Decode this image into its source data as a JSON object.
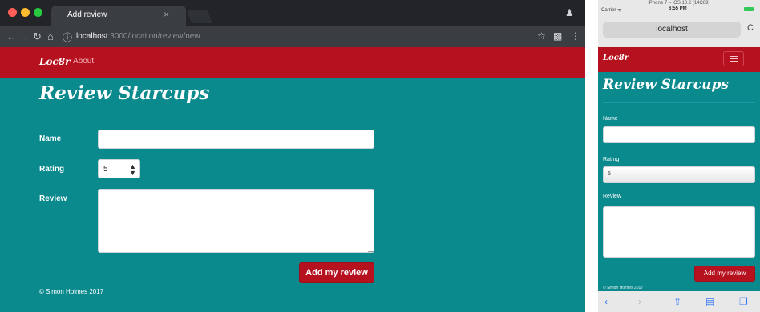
{
  "desktop": {
    "tab_title": "Add review",
    "tab_close": "×",
    "url_host": "localhost",
    "url_path": ":3000/location/review/new",
    "nav": {
      "brand": "Loc8r",
      "about": "About"
    },
    "heading": "Review Starcups",
    "form": {
      "name_label": "Name",
      "name_value": "",
      "rating_label": "Rating",
      "rating_value": "5",
      "review_label": "Review",
      "review_value": "",
      "submit_label": "Add my review"
    },
    "footer": "© Simon Holmes 2017"
  },
  "phone": {
    "device_title": "iPhone 7 – iOS 10.2 (14C89)",
    "carrier": "Carrier ᯤ",
    "time": "6:55 PM",
    "url": "localhost",
    "nav": {
      "brand": "Loc8r"
    },
    "heading": "Review Starcups",
    "form": {
      "name_label": "Name",
      "rating_label": "Rating",
      "rating_value": "5",
      "review_label": "Review",
      "submit_label": "Add my review"
    },
    "footer": "© Simon Holmes 2017"
  },
  "colors": {
    "brand_red": "#b5111e",
    "page_teal": "#0b8a8e"
  },
  "icons": [
    "back-icon",
    "forward-icon",
    "reload-icon",
    "home-icon",
    "info-icon",
    "star-icon",
    "extension-icon",
    "more-icon",
    "hamburger-icon",
    "share-icon",
    "bookmarks-icon",
    "tabs-icon"
  ]
}
